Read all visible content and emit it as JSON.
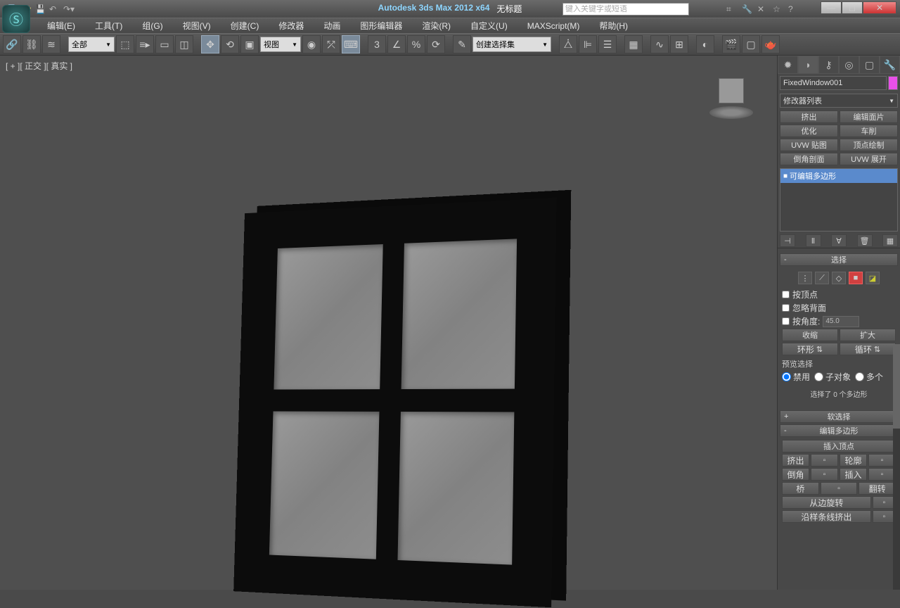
{
  "titlebar": {
    "app": "Autodesk 3ds Max  2012 x64",
    "doc": "无标题",
    "search_placeholder": "键入关键字或短语"
  },
  "menu": {
    "edit": "编辑(E)",
    "tools": "工具(T)",
    "group": "组(G)",
    "views": "视图(V)",
    "create": "创建(C)",
    "modifiers": "修改器",
    "animation": "动画",
    "graph": "图形编辑器",
    "render": "渲染(R)",
    "custom": "自定义(U)",
    "maxscript": "MAXScript(M)",
    "help": "帮助(H)"
  },
  "toolbar": {
    "selection_filter": "全部",
    "ref_system": "视图",
    "named_set": "创建选择集"
  },
  "viewport": {
    "label": "[ + ][ 正交 ][ 真实 ]"
  },
  "panel": {
    "object_name": "FixedWindow001",
    "modifier_list": "修改器列表",
    "mod_buttons": {
      "extrude": "挤出",
      "edit_patch": "编辑面片",
      "optimize": "优化",
      "lathe": "车削",
      "uvw_map": "UVW 贴图",
      "vertex_paint": "顶点绘制",
      "chamfer_profile": "倒角剖面",
      "uvw_unwrap": "UVW 展开"
    },
    "stack_item": "可编辑多边形",
    "rollout_select": "选择",
    "by_vertex": "按顶点",
    "ignore_backfacing": "忽略背面",
    "by_angle": "按角度:",
    "angle_val": "45.0",
    "shrink": "收缩",
    "grow": "扩大",
    "ring": "环形",
    "loop": "循环",
    "preview_label": "预览选择",
    "preview_off": "禁用",
    "preview_sub": "子对象",
    "preview_multi": "多个",
    "sel_status": "选择了 0 个多边形",
    "rollout_soft": "软选择",
    "rollout_edit_poly": "编辑多边形",
    "insert_vertex": "插入顶点",
    "extrude2": "挤出",
    "outline": "轮廓",
    "bevel": "倒角",
    "inset": "插入",
    "bridge": "桥",
    "flip": "翻转",
    "hinge": "从边旋转",
    "extrude_spline": "沿样条线挤出"
  }
}
